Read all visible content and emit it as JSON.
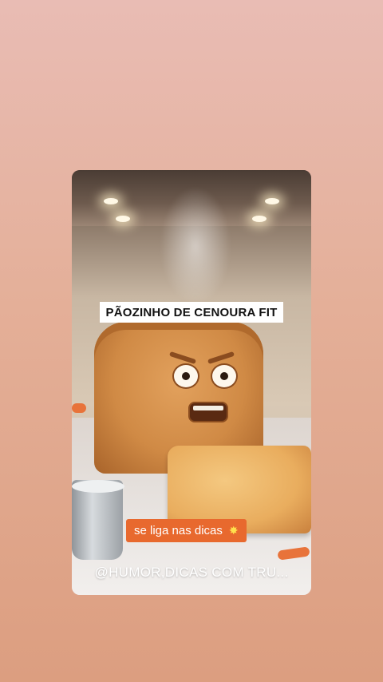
{
  "story": {
    "title_caption": "PÃOZINHO DE CENOURA FIT",
    "tip_caption": "se liga nas dicas",
    "tip_icon": "collision-icon",
    "handle": "@HUMOR,DICAS COM TRU..."
  },
  "colors": {
    "page_background": "#e4af98",
    "tip_badge": "#e8692e",
    "caption_background": "#ffffff"
  }
}
